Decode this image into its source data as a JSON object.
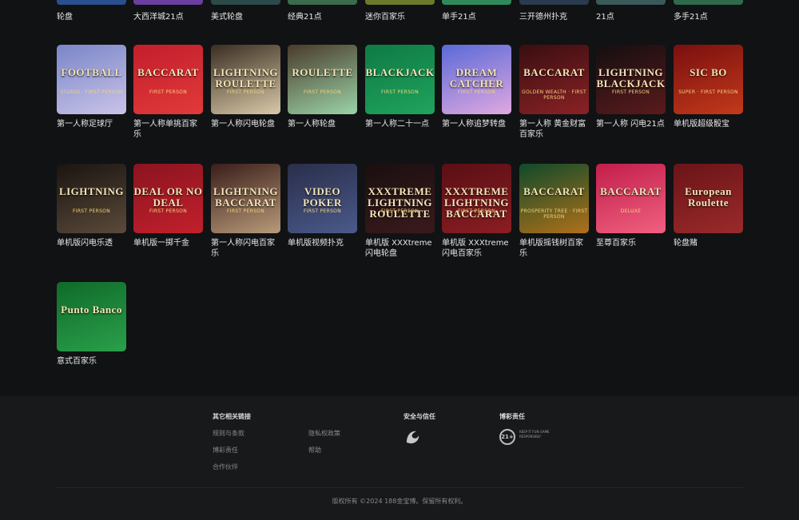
{
  "top_row": [
    {
      "title": "轮盘",
      "color": "#2a4f8f"
    },
    {
      "title": "大西洋城21点",
      "color": "#6a3fa0"
    },
    {
      "title": "美式轮盘",
      "color": "#2d4a4a"
    },
    {
      "title": "经典21点",
      "color": "#3b6b4a"
    },
    {
      "title": "迷你百家乐",
      "color": "#6b7a2a"
    },
    {
      "title": "单手21点",
      "color": "#2f8a5a"
    },
    {
      "title": "三开德州扑克",
      "color": "#2a3a4f"
    },
    {
      "title": "21点",
      "color": "#3a5a5a"
    },
    {
      "title": "多手21点",
      "color": "#2f6a4a"
    }
  ],
  "games": [
    {
      "title": "第一人称足球厅",
      "art": "FOOTBALL",
      "sub": "STUDIO · FIRST PERSON",
      "bg": "#7a86c8",
      "bg2": "#c9c3e8"
    },
    {
      "title": "第一人称单挑百家乐",
      "art": "BACCARAT",
      "sub": "FIRST PERSON",
      "bg": "#c21e2c",
      "bg2": "#e23a3a"
    },
    {
      "title": "第一人称闪电轮盘",
      "art": "LIGHTNING ROULETTE",
      "sub": "FIRST PERSON",
      "bg": "#3a2e22",
      "bg2": "#d9c9a8"
    },
    {
      "title": "第一人称轮盘",
      "art": "ROULETTE",
      "sub": "FIRST PERSON",
      "bg": "#4a3b2a",
      "bg2": "#9bd3a8"
    },
    {
      "title": "第一人称二十一点",
      "art": "BLACKJACK",
      "sub": "FIRST PERSON",
      "bg": "#0f7a45",
      "bg2": "#1fa35c"
    },
    {
      "title": "第一人称追梦转盘",
      "art": "DREAM CATCHER",
      "sub": "FIRST PERSON",
      "bg": "#5a6ad8",
      "bg2": "#e0a8e0"
    },
    {
      "title": "第一人称 黄金财富百家乐",
      "art": "BACCARAT",
      "sub": "GOLDEN WEALTH · FIRST PERSON",
      "bg": "#3a0e10",
      "bg2": "#8a2226"
    },
    {
      "title": "第一人称 闪电21点",
      "art": "LIGHTNING BLACKJACK",
      "sub": "FIRST PERSON",
      "bg": "#140f10",
      "bg2": "#5a1a1c"
    },
    {
      "title": "单机版超级骰宝",
      "art": "SIC BO",
      "sub": "SUPER · FIRST PERSON",
      "bg": "#7a0f0f",
      "bg2": "#c23a1a"
    },
    {
      "title": "单机版闪电乐透",
      "art": "LIGHTNING",
      "sub": "FIRST PERSON",
      "bg": "#1a1410",
      "bg2": "#5a4a3a"
    },
    {
      "title": "单机版一掷千金",
      "art": "DEAL OR NO DEAL",
      "sub": "FIRST PERSON",
      "bg": "#8a1420",
      "bg2": "#c2202c"
    },
    {
      "title": "第一人称闪电百家乐",
      "art": "LIGHTNING BACCARAT",
      "sub": "FIRST PERSON",
      "bg": "#3a1e1a",
      "bg2": "#b89a7a"
    },
    {
      "title": "单机版视频扑克",
      "art": "VIDEO POKER",
      "sub": "FIRST PERSON",
      "bg": "#2a2e4a",
      "bg2": "#4a5a8a"
    },
    {
      "title": "单机版 XXXtreme 闪电轮盘",
      "art": "XXXTREME LIGHTNING ROULETTE",
      "sub": "FIRST PERSON",
      "bg": "#1a0f10",
      "bg2": "#3a1a1c"
    },
    {
      "title": "单机版 XXXtreme 闪电百家乐",
      "art": "XXXTREME LIGHTNING BACCARAT",
      "sub": "FIRST PERSON",
      "bg": "#5a0f14",
      "bg2": "#8a1e24"
    },
    {
      "title": "单机版摇钱树百家乐",
      "art": "BACCARAT",
      "sub": "PROSPERITY TREE · FIRST PERSON",
      "bg": "#0f4a2a",
      "bg2": "#b0701a"
    },
    {
      "title": "至尊百家乐",
      "art": "BACCARAT",
      "sub": "DELUXE",
      "bg": "#c21e4a",
      "bg2": "#f06080"
    },
    {
      "title": "轮盘赌",
      "art": "European Roulette",
      "sub": "",
      "bg": "#6a1418",
      "bg2": "#9a2a2a"
    },
    {
      "title": "意式百家乐",
      "art": "Punto Banco",
      "sub": "",
      "bg": "#0f6a2a",
      "bg2": "#2aa04a"
    }
  ],
  "footer": {
    "col1": {
      "heading": "其它相关链接",
      "links": [
        "规则与条款",
        "博彩责任",
        "合作伙伴"
      ]
    },
    "col2": {
      "links": [
        "隐私权政策",
        "帮助"
      ]
    },
    "col3": {
      "heading": "安全与信任"
    },
    "col4": {
      "heading": "博彩责任",
      "badge": "21+",
      "badge_text": "KEEP IT FUN GAME RESPONSIBLY"
    },
    "copyright": "版权所有 ©2024 188金宝博。保留所有权利。"
  }
}
